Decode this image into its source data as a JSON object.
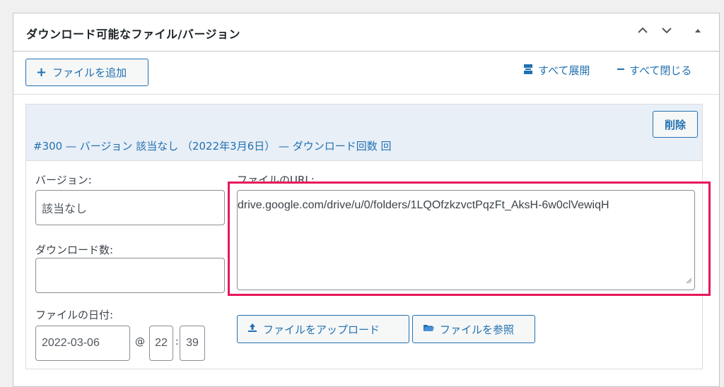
{
  "panel": {
    "title": "ダウンロード可能なファイル/バージョン"
  },
  "toolbar": {
    "add_label": "ファイルを追加",
    "expand_all": "すべて展開",
    "collapse_all": "すべて閉じる"
  },
  "item": {
    "title": "#300 — バージョン 該当なし （2022年3月6日） — ダウンロード回数 回",
    "delete_label": "削除",
    "version_label": "バージョン:",
    "version_value": "該当なし",
    "download_count_label": "ダウンロード数:",
    "download_count_value": "",
    "file_date_label": "ファイルの日付:",
    "date_value": "2022-03-06",
    "at_symbol": "@",
    "hour_value": "22",
    "time_separator": ":",
    "minute_value": "39",
    "url_label": "ファイルのURL:",
    "url_value": "drive.google.com/drive/u/0/folders/1LQOfzkzvctPqzFt_AksH-6w0clVewiqH",
    "upload_label": "ファイルをアップロード",
    "browse_label": "ファイルを参照"
  },
  "colors": {
    "accent": "#2271b1",
    "highlight": "#e6195a",
    "item_header_bg": "#e9eff7"
  }
}
